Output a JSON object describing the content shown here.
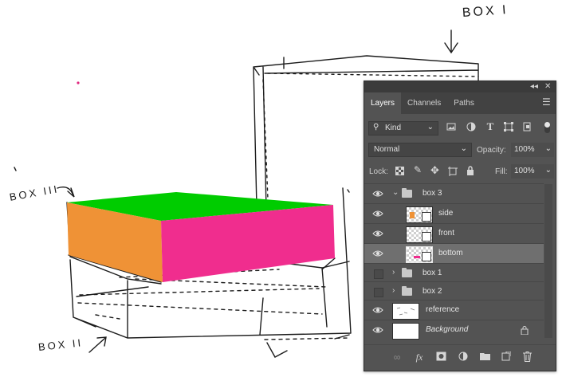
{
  "sketch": {
    "labels": {
      "box1": "BOX I",
      "box2": "BOX II",
      "box3": "BOX III"
    },
    "colors": {
      "top": "#00cc00",
      "front": "#f02d8e",
      "side": "#ef9236"
    }
  },
  "panel": {
    "collapse_icon": "double-chevron-icon",
    "close_icon": "close-icon",
    "tabs": [
      {
        "label": "Layers",
        "active": true
      },
      {
        "label": "Channels",
        "active": false
      },
      {
        "label": "Paths",
        "active": false
      }
    ],
    "menu_icon": "panel-menu-icon",
    "filter": {
      "kind_label": "Kind",
      "icons": [
        "pixel-filter-icon",
        "adjustment-filter-icon",
        "type-filter-icon",
        "shape-filter-icon",
        "smart-object-filter-icon"
      ]
    },
    "blend_mode": "Normal",
    "opacity_label": "Opacity:",
    "opacity_value": "100%",
    "lock_label": "Lock:",
    "fill_label": "Fill:",
    "fill_value": "100%",
    "layers": [
      {
        "name": "box 3",
        "visible": true,
        "type": "group",
        "expanded": true
      },
      {
        "name": "side",
        "visible": true,
        "type": "smart",
        "indent": true
      },
      {
        "name": "front",
        "visible": true,
        "type": "smart",
        "indent": true
      },
      {
        "name": "bottom",
        "visible": true,
        "type": "smart",
        "indent": true,
        "selected": true
      },
      {
        "name": "box 1",
        "visible": false,
        "type": "group",
        "expanded": false
      },
      {
        "name": "box 2",
        "visible": false,
        "type": "group",
        "expanded": false
      },
      {
        "name": "reference",
        "visible": true,
        "type": "raster"
      },
      {
        "name": "Background",
        "visible": true,
        "type": "background",
        "locked": true
      }
    ],
    "bottom_icons": [
      "link-layers-icon",
      "fx-icon",
      "add-mask-icon",
      "adjustment-layer-icon",
      "new-group-icon",
      "new-layer-icon",
      "delete-layer-icon"
    ]
  }
}
